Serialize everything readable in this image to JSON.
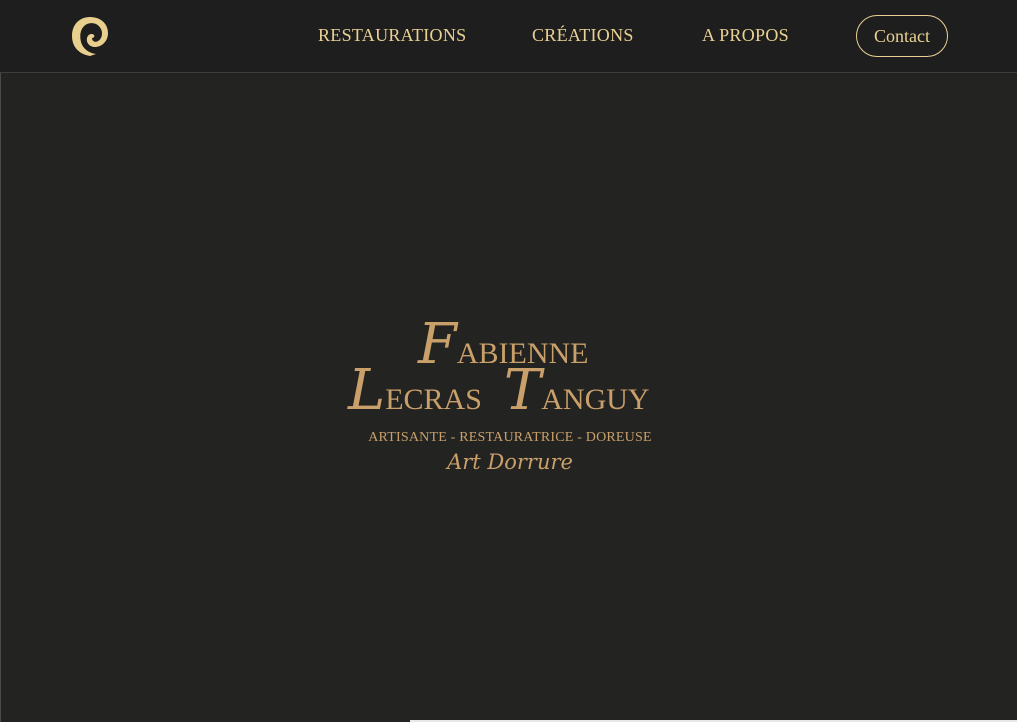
{
  "header": {
    "logo_icon": "swirl-logo-icon",
    "nav": [
      {
        "label": "RESTAURATIONS"
      },
      {
        "label": "CRÉATIONS"
      },
      {
        "label": "A PROPOS"
      }
    ],
    "contact_label": "Contact"
  },
  "hero": {
    "first_cap": "F",
    "first_rest": "ABIENNE",
    "second_cap": "L",
    "second_rest": "ECRAS",
    "third_cap": "T",
    "third_rest": "ANGUY",
    "tagline": "ARTISANTE - RESTAURATRICE - DOREUSE",
    "script": "Art Dorrure"
  },
  "colors": {
    "gold": "#e9d193",
    "title": "#c9a06a",
    "background": "#232321",
    "header": "#1e1e1e"
  }
}
